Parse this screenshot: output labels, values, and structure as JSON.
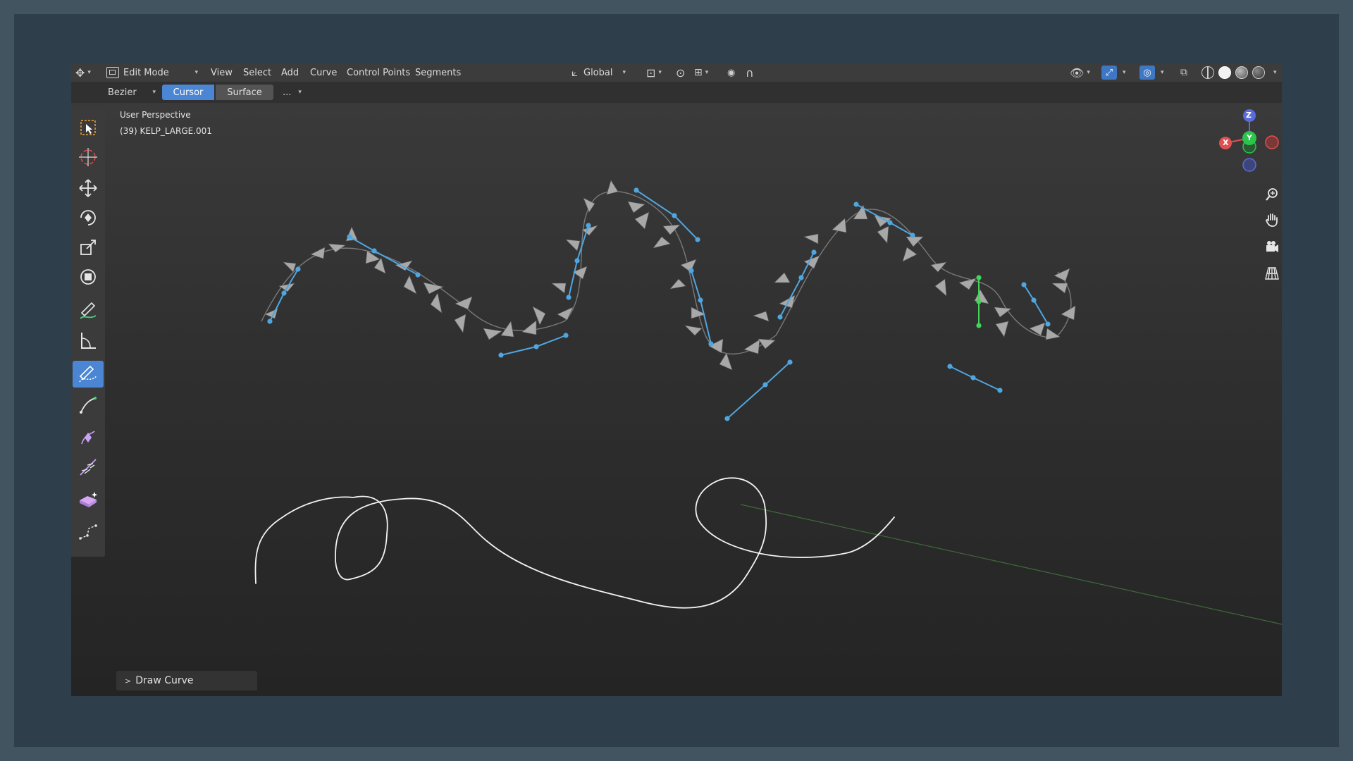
{
  "header": {
    "mode": "Edit Mode",
    "menus": [
      "View",
      "Select",
      "Add",
      "Curve",
      "Control Points",
      "Segments"
    ],
    "orientation": "Global"
  },
  "tool_settings": {
    "curve_type": "Bezier",
    "depth_cursor": "Cursor",
    "depth_surface": "Surface",
    "more": "..."
  },
  "viewport": {
    "view_name": "User Perspective",
    "object_name": "(39) KELP_LARGE.001"
  },
  "gizmo": {
    "z": "Z",
    "y": "Y",
    "x": "X"
  },
  "operator_panel": {
    "label": "Draw Curve"
  },
  "colors": {
    "accent": "#4a86d4",
    "control_points": "#4fa6e0",
    "axis_x": "#e05050",
    "axis_y": "#2ac54a",
    "axis_z": "#5a6cd9"
  }
}
